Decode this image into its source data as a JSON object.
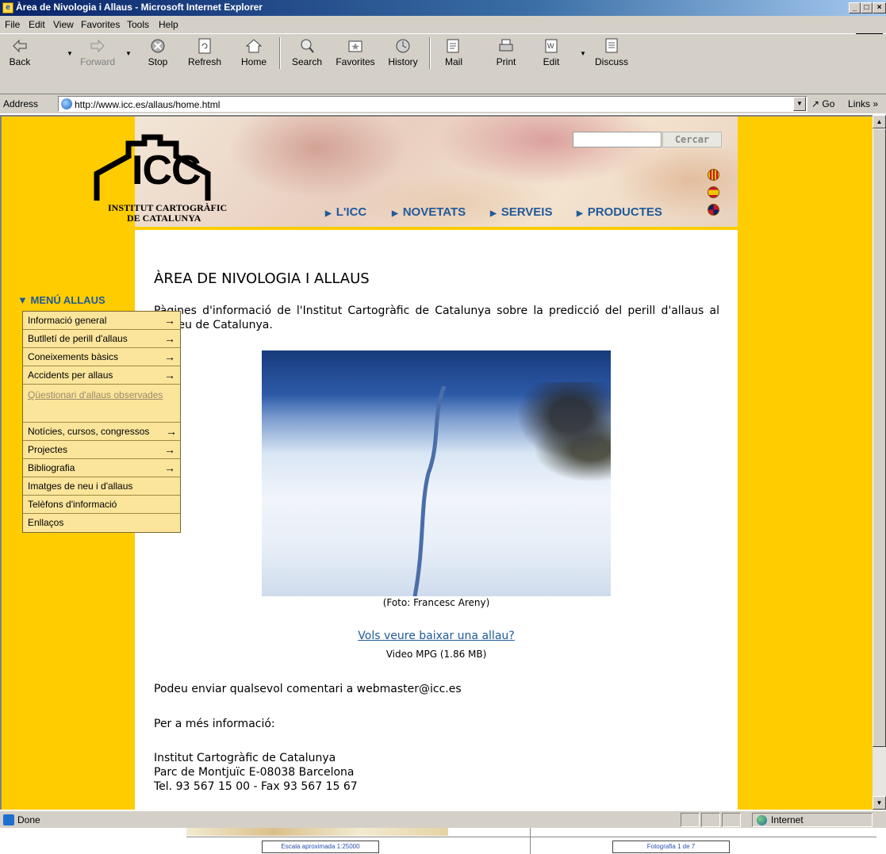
{
  "window": {
    "title": "Àrea de Nivologia i Allaus - Microsoft Internet Explorer",
    "controls": [
      "_",
      "□",
      "×"
    ]
  },
  "menubar": [
    "File",
    "Edit",
    "View",
    "Favorites",
    "Tools",
    "Help"
  ],
  "toolbar": {
    "back": "Back",
    "forward": "Forward",
    "stop": "Stop",
    "refresh": "Refresh",
    "home": "Home",
    "search": "Search",
    "favorites": "Favorites",
    "history": "History",
    "mail": "Mail",
    "print": "Print",
    "edit": "Edit",
    "discuss": "Discuss"
  },
  "address": {
    "label": "Address",
    "url": "http://www.icc.es/allaus/home.html",
    "go": "Go",
    "links": "Links »"
  },
  "header": {
    "logo_main": "ICC",
    "logo_line1": "INSTITUT CARTOGRÀFIC",
    "logo_line2": "DE CATALUNYA",
    "search_button": "Cercar",
    "nav": [
      "L'ICC",
      "NOVETATS",
      "SERVEIS",
      "PRODUCTES"
    ]
  },
  "menu": {
    "title": "MENÚ ALLAUS",
    "items": [
      {
        "label": "Informació general",
        "arrow": "→"
      },
      {
        "label": "Butlletí de perill d'allaus",
        "arrow": "→"
      },
      {
        "label": "Coneixements bàsics",
        "arrow": "→"
      },
      {
        "label": "Accidents per allaus",
        "arrow": "→"
      },
      {
        "label": "Qüestionari d'allaus observades",
        "arrow": ""
      },
      {
        "label": "Notícies, cursos, congressos",
        "arrow": "→"
      },
      {
        "label": "Projectes",
        "arrow": "→"
      },
      {
        "label": "Bibliografia",
        "arrow": "→"
      },
      {
        "label": "Imatges de neu i d'allaus",
        "arrow": ""
      },
      {
        "label": "Telèfons d'informació",
        "arrow": ""
      },
      {
        "label": "Enllaços",
        "arrow": ""
      }
    ]
  },
  "content": {
    "title": "ÀREA DE NIVOLOGIA I ALLAUS",
    "intro": "Pàgines d'informació de l'Institut Cartogràfic de Catalunya sobre la predicció del perill d'allaus al Pirineu de Catalunya.",
    "photo_caption": "(Foto: Francesc Areny)",
    "video_link": "Vols veure baixar una allau?",
    "video_info": "Video MPG (1.86 MB)",
    "comments": "Podeu enviar qualsevol comentari a webmaster@icc.es",
    "more_info": "Per a més informació:",
    "address_line1": "Institut Cartogràfic de Catalunya",
    "address_line2": "Parc de Montjuïc E-08038 Barcelona",
    "address_line3": "Tel. 93 567 15 00 - Fax 93 567 15 67"
  },
  "statusbar": {
    "status": "Done",
    "zone": "Internet"
  },
  "background": {
    "scale_box": "Escala aproximada 1:25000",
    "photo_box": "Fotografia 1 de 7"
  }
}
